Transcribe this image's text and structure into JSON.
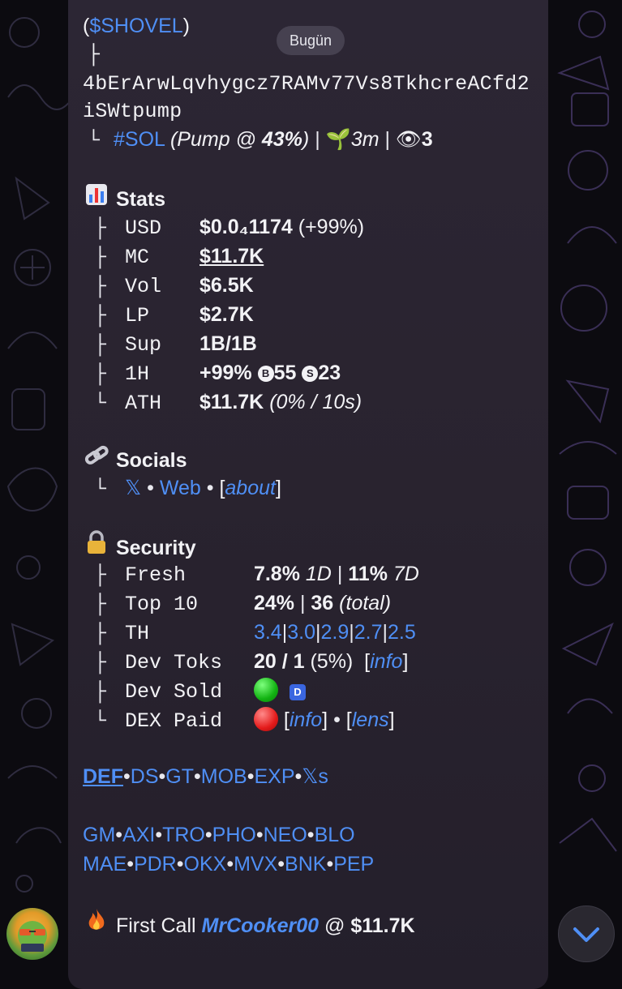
{
  "day_label": "Bugün",
  "token": {
    "ticker": "$SHOVEL",
    "address_line1": "4bErArwLqvhygcz7RAMv77Vs8TkhcreACfd2",
    "address_line2": "iSWtpump",
    "chain": "#SOL",
    "pump_prefix": "(Pump @ ",
    "pump_pct": "43%",
    "pump_suffix": ")",
    "age": "3m",
    "views": "3"
  },
  "stats": {
    "heading": "Stats",
    "rows": [
      {
        "key": "USD",
        "value": "$0.0₄1174",
        "extra": " (+99%)"
      },
      {
        "key": "MC",
        "value": "$11.7K"
      },
      {
        "key": "Vol",
        "value": "$6.5K"
      },
      {
        "key": "LP",
        "value": "$2.7K"
      },
      {
        "key": "Sup",
        "value": "1B/1B"
      },
      {
        "key": "1H",
        "value": "+99%",
        "buys_icon": "B",
        "buys": "55",
        "sells_icon": "S",
        "sells": "23"
      },
      {
        "key": "ATH",
        "value": "$11.7K",
        "extra": " (0% / 10s)"
      }
    ]
  },
  "socials": {
    "heading": "Socials",
    "x": "𝕏",
    "web": "Web",
    "about": "about"
  },
  "security": {
    "heading": "Security",
    "fresh": {
      "key": "Fresh",
      "v1": "7.8%",
      "l1": "1D",
      "v2": "11%",
      "l2": "7D"
    },
    "top10": {
      "key": "Top 10",
      "v1": "24%",
      "v2": "36",
      "l2": "(total)"
    },
    "th": {
      "key": "TH",
      "values": [
        "3.4",
        "3.0",
        "2.9",
        "2.7",
        "2.5"
      ]
    },
    "dev_toks": {
      "key": "Dev Toks",
      "value": "20 / 1",
      "pct": "(5%)",
      "info": "info"
    },
    "dev_sold": {
      "key": "Dev Sold",
      "badge": "D"
    },
    "dex_paid": {
      "key": "DEX Paid",
      "info": "info",
      "lens": "lens"
    }
  },
  "links_row1": [
    "DEF",
    "DS",
    "GT",
    "MOB",
    "EXP",
    "𝕏s"
  ],
  "links_row2": [
    "GM",
    "AXI",
    "TRO",
    "PHO",
    "NEO",
    "BLO"
  ],
  "links_row3": [
    "MAE",
    "PDR",
    "OKX",
    "MVX",
    "BNK",
    "PEP"
  ],
  "first_call": {
    "label": "First Call",
    "user": "MrCooker00",
    "at": "@",
    "value": "$11.7K"
  },
  "colors": {
    "link": "#4f8ff5",
    "bubble": "#29232f",
    "background": "#0c0b10"
  },
  "icons": {
    "stats": "bar-chart-icon",
    "socials": "link-icon",
    "security": "lock-icon",
    "fire": "fire-icon",
    "sprout": "seedling-icon",
    "eye": "eye-icon"
  }
}
